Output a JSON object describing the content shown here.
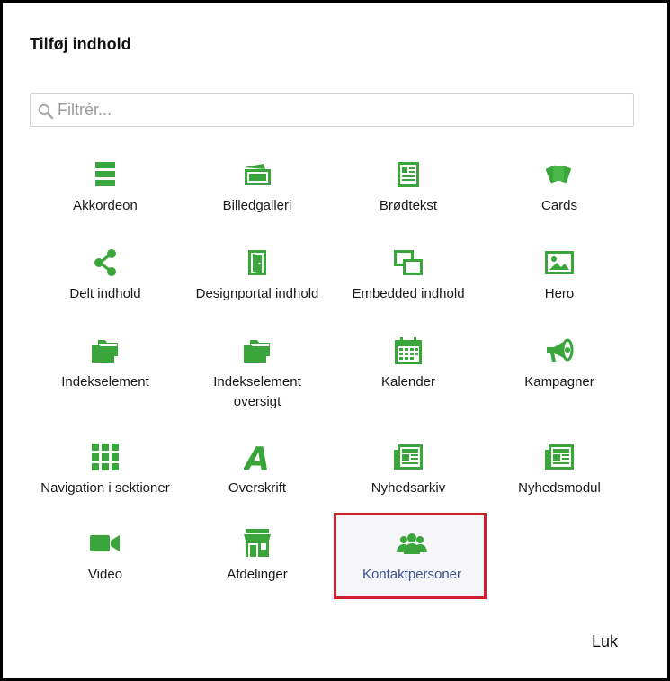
{
  "dialog": {
    "title": "Tilføj indhold",
    "close_label": "Luk"
  },
  "search": {
    "placeholder": "Filtrér..."
  },
  "colors": {
    "icon": "#3aa53a",
    "selected_text": "#3f4f8f",
    "highlight_border": "#d0202e"
  },
  "items": [
    {
      "label": "Akkordeon",
      "icon": "accordion-icon"
    },
    {
      "label": "Billedgalleri",
      "icon": "image-gallery-icon"
    },
    {
      "label": "Brødtekst",
      "icon": "body-text-icon"
    },
    {
      "label": "Cards",
      "icon": "cards-icon"
    },
    {
      "label": "Delt indhold",
      "icon": "share-icon"
    },
    {
      "label": "Designportal indhold",
      "icon": "door-icon"
    },
    {
      "label": "Embedded indhold",
      "icon": "embedded-icon"
    },
    {
      "label": "Hero",
      "icon": "hero-image-icon"
    },
    {
      "label": "Indekselement",
      "icon": "folder-icon"
    },
    {
      "label": "Indekselement oversigt",
      "icon": "folder-icon"
    },
    {
      "label": "Kalender",
      "icon": "calendar-icon"
    },
    {
      "label": "Kampagner",
      "icon": "megaphone-icon"
    },
    {
      "label": "Navigation i sektioner",
      "icon": "grid-icon"
    },
    {
      "label": "Overskrift",
      "icon": "heading-icon"
    },
    {
      "label": "Nyhedsarkiv",
      "icon": "newspaper-icon"
    },
    {
      "label": "Nyhedsmodul",
      "icon": "newspaper-icon"
    },
    {
      "label": "Video",
      "icon": "video-camera-icon"
    },
    {
      "label": "Afdelinger",
      "icon": "store-icon"
    },
    {
      "label": "Kontaktpersoner",
      "icon": "people-icon",
      "selected": true
    }
  ]
}
